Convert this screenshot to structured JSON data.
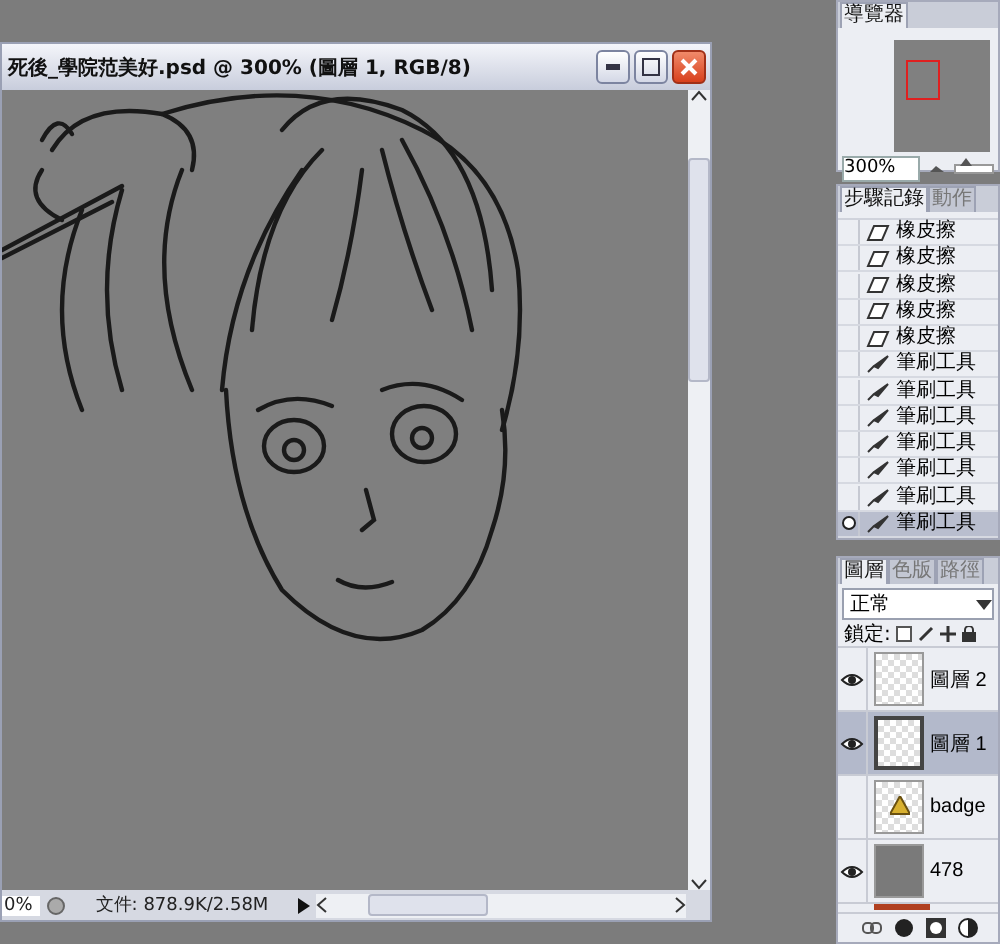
{
  "document": {
    "title": "死後_學院范美好.psd @ 300% (圖層 1, RGB/8)",
    "status_zoom": "0%",
    "file_info": "文件: 878.9K/2.58M"
  },
  "navigator": {
    "tab": "導覽器",
    "zoom": "300%",
    "level": 0.25
  },
  "history": {
    "tabs": [
      {
        "label": "步驟記錄",
        "selected": true
      },
      {
        "label": "動作",
        "selected": false
      }
    ],
    "steps": [
      {
        "label": "橡皮擦",
        "kind": "eraser",
        "selected": false
      },
      {
        "label": "橡皮擦",
        "kind": "eraser",
        "selected": false
      },
      {
        "label": "橡皮擦",
        "kind": "eraser",
        "selected": false
      },
      {
        "label": "橡皮擦",
        "kind": "eraser",
        "selected": false
      },
      {
        "label": "橡皮擦",
        "kind": "eraser",
        "selected": false
      },
      {
        "label": "筆刷工具",
        "kind": "brush",
        "selected": false
      },
      {
        "label": "筆刷工具",
        "kind": "brush",
        "selected": false
      },
      {
        "label": "筆刷工具",
        "kind": "brush",
        "selected": false
      },
      {
        "label": "筆刷工具",
        "kind": "brush",
        "selected": false
      },
      {
        "label": "筆刷工具",
        "kind": "brush",
        "selected": false
      },
      {
        "label": "筆刷工具",
        "kind": "brush",
        "selected": false
      },
      {
        "label": "筆刷工具",
        "kind": "brush",
        "selected": true
      }
    ]
  },
  "layers": {
    "tabs": [
      {
        "label": "圖層",
        "selected": true
      },
      {
        "label": "色版",
        "selected": false
      },
      {
        "label": "路徑",
        "selected": false
      }
    ],
    "blend_mode": "正常",
    "lock_label": "鎖定:",
    "items": [
      {
        "name": "圖層 2",
        "kind": "transparent",
        "visible": true,
        "selected": false
      },
      {
        "name": "圖層 1",
        "kind": "transparent",
        "visible": true,
        "selected": true
      },
      {
        "name": "badge",
        "kind": "image",
        "visible": false,
        "selected": false
      },
      {
        "name": "478",
        "kind": "fill",
        "visible": true,
        "selected": false
      }
    ]
  }
}
